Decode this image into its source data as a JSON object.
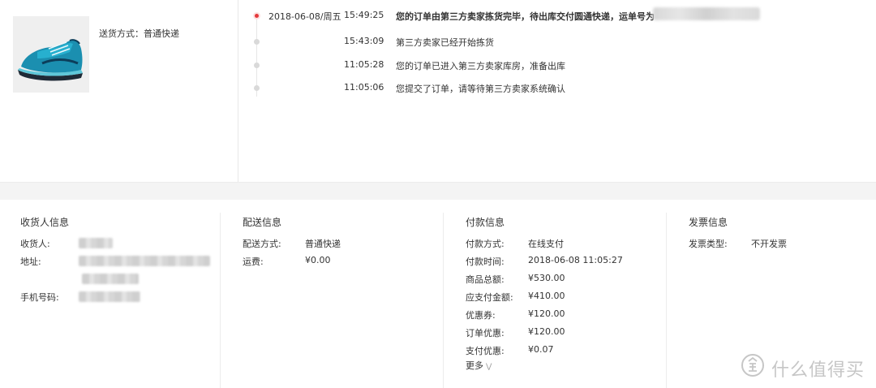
{
  "product": {
    "image_alt": "running-shoe",
    "shipping_method": "送货方式：普通快递"
  },
  "timeline": [
    {
      "date": "2018-06-08/周五",
      "time": "15:49:25",
      "desc": "您的订单由第三方卖家拣货完毕，待出库交付圆通快递，运单号为",
      "active": true
    },
    {
      "date": "",
      "time": "15:43:09",
      "desc": "第三方卖家已经开始拣货",
      "active": false
    },
    {
      "date": "",
      "time": "11:05:28",
      "desc": "您的订单已进入第三方卖家库房，准备出库",
      "active": false
    },
    {
      "date": "",
      "time": "11:05:06",
      "desc": "您提交了订单，请等待第三方卖家系统确认",
      "active": false
    }
  ],
  "recipient": {
    "title": "收货人信息",
    "name_label": "收货人:",
    "address_label": "地址:",
    "phone_label": "手机号码:"
  },
  "delivery": {
    "title": "配送信息",
    "method_label": "配送方式:",
    "method_value": "普通快递",
    "fee_label": "运费:",
    "fee_value": "¥0.00"
  },
  "payment": {
    "title": "付款信息",
    "rows": [
      {
        "label": "付款方式:",
        "value": "在线支付"
      },
      {
        "label": "付款时间:",
        "value": "2018-06-08 11:05:27"
      },
      {
        "label": "商品总额:",
        "value": "¥530.00"
      },
      {
        "label": "应支付金额:",
        "value": "¥410.00"
      },
      {
        "label": "优惠券:",
        "value": "¥120.00"
      },
      {
        "label": "订单优惠:",
        "value": "¥120.00"
      },
      {
        "label": "支付优惠:",
        "value": "¥0.07"
      }
    ],
    "more_label": "更多"
  },
  "invoice": {
    "title": "发票信息",
    "type_label": "发票类型:",
    "type_value": "不开发票"
  },
  "watermark": {
    "text": "什么值得买",
    "badge": "值"
  },
  "colors": {
    "active_dot": "#e4393c",
    "band": "#f4f4f4",
    "text": "#333333"
  }
}
